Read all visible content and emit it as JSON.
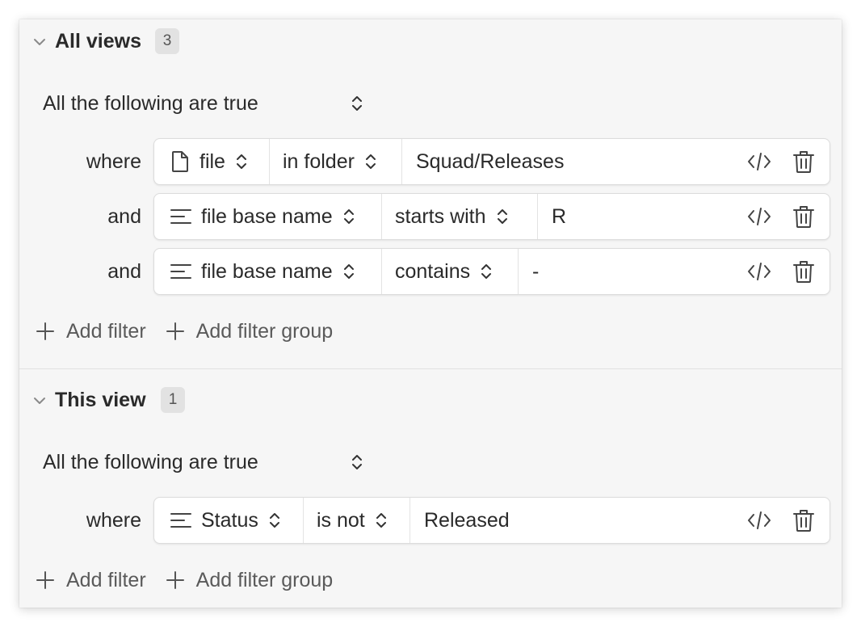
{
  "sections": [
    {
      "title": "All views",
      "count": "3",
      "conjunction": "All the following are true",
      "filters": [
        {
          "label": "where",
          "property": "file",
          "property_icon": "file-icon",
          "operator": "in folder",
          "value": "Squad/Releases"
        },
        {
          "label": "and",
          "property": "file base name",
          "property_icon": "text-lines-icon",
          "operator": "starts with",
          "value": "R"
        },
        {
          "label": "and",
          "property": "file base name",
          "property_icon": "text-lines-icon",
          "operator": "contains",
          "value": "-"
        }
      ],
      "add_filter": "Add filter",
      "add_filter_group": "Add filter group"
    },
    {
      "title": "This view",
      "count": "1",
      "conjunction": "All the following are true",
      "filters": [
        {
          "label": "where",
          "property": "Status",
          "property_icon": "text-lines-icon",
          "operator": "is not",
          "value": "Released"
        }
      ],
      "add_filter": "Add filter",
      "add_filter_group": "Add filter group"
    }
  ]
}
